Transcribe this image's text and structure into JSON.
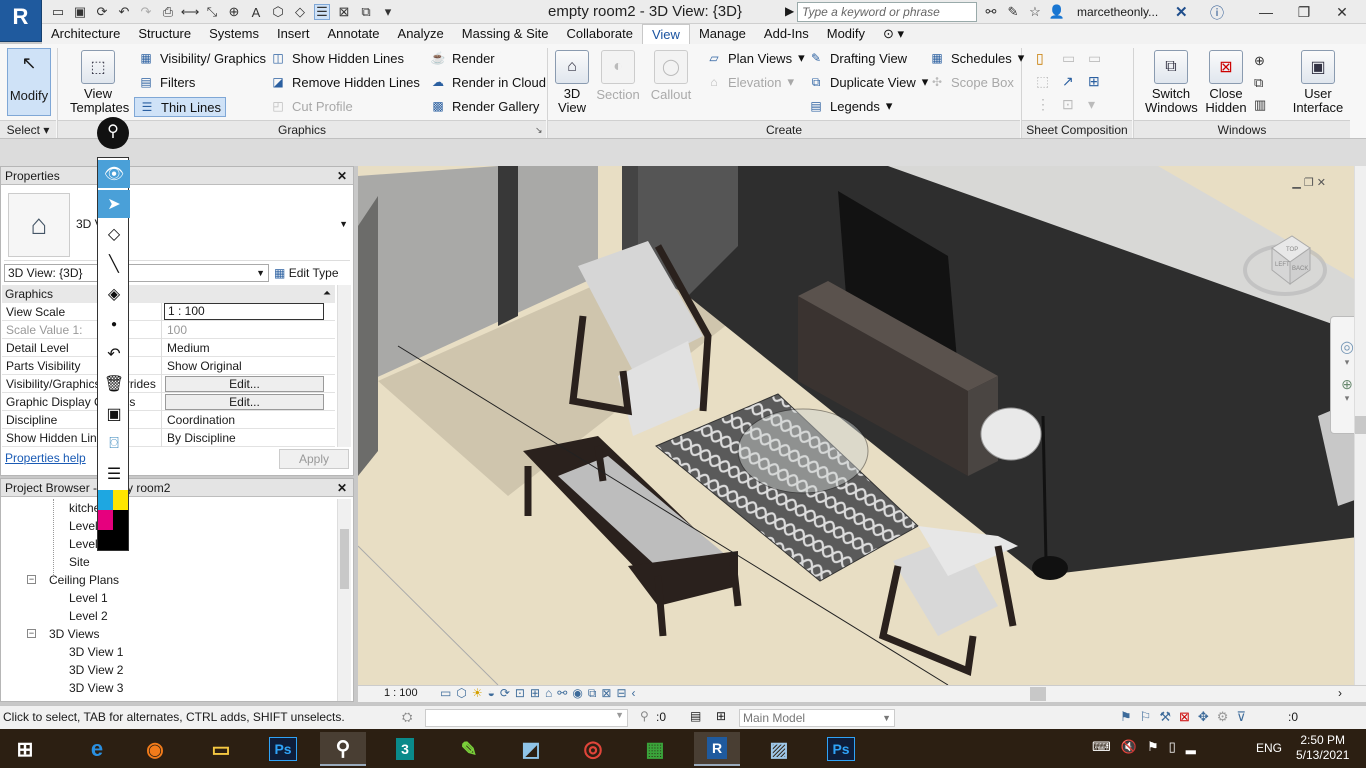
{
  "app": {
    "logo": "R",
    "title": "empty room2 - 3D View: {3D}",
    "search_placeholder": "Type a keyword or phrase",
    "user": "marcetheonly..."
  },
  "menu_tabs": [
    "Architecture",
    "Structure",
    "Systems",
    "Insert",
    "Annotate",
    "Analyze",
    "Massing & Site",
    "Collaborate",
    "View",
    "Manage",
    "Add-Ins",
    "Modify"
  ],
  "active_tab": "View",
  "ribbon": {
    "modify": "Modify",
    "select": "Select",
    "view_templates": "View\nTemplates",
    "visibility": "Visibility/ Graphics",
    "filters": "Filters",
    "thin_lines": "Thin Lines",
    "show_hidden": "Show  Hidden Lines",
    "remove_hidden": "Remove  Hidden Lines",
    "cut_profile": "Cut  Profile",
    "render": "Render",
    "render_cloud": "Render  in Cloud",
    "render_gallery": "Render  Gallery",
    "graphics_panel": "Graphics",
    "view3d": "3D\nView",
    "section": "Section",
    "callout": "Callout",
    "plan_views": "Plan  Views",
    "elevation": "Elevation",
    "drafting_view": "Drafting  View",
    "duplicate_view": "Duplicate  View",
    "legends": "Legends",
    "schedules": "Schedules",
    "scope_box": "Scope  Box",
    "create_panel": "Create",
    "sheet_panel": "Sheet Composition",
    "switch_windows": "Switch\nWindows",
    "close_hidden": "Close\nHidden",
    "user_interface": "User\nInterface",
    "windows_panel": "Windows"
  },
  "properties": {
    "title": "Properties",
    "type_name": "3D View",
    "selector": "3D View: {3D}",
    "edit_type": "Edit Type",
    "section": "Graphics",
    "rows": [
      {
        "label": "View Scale",
        "value": "1 : 100"
      },
      {
        "label": "Scale Value    1:",
        "value": "100"
      },
      {
        "label": "Detail Level",
        "value": "Medium"
      },
      {
        "label": "Parts Visibility",
        "value": "Show Original"
      },
      {
        "label": "Visibility/Graphics Overrides",
        "value": "Edit..."
      },
      {
        "label": "Graphic Display Options",
        "value": "Edit..."
      },
      {
        "label": "Discipline",
        "value": "Coordination"
      },
      {
        "label": "Show Hidden Lines",
        "value": "By Discipline"
      }
    ],
    "help": "Properties help",
    "apply": "Apply"
  },
  "browser": {
    "title": "Project Browser - empty room2",
    "items": [
      {
        "label": "kitchen",
        "indent": 3
      },
      {
        "label": "Level 1",
        "indent": 3
      },
      {
        "label": "Level 2",
        "indent": 3
      },
      {
        "label": "Site",
        "indent": 3
      },
      {
        "label": "Ceiling Plans",
        "indent": 2
      },
      {
        "label": "Level 1",
        "indent": 3
      },
      {
        "label": "Level 2",
        "indent": 3
      },
      {
        "label": "3D Views",
        "indent": 2
      },
      {
        "label": "3D View 1",
        "indent": 3
      },
      {
        "label": "3D View 2",
        "indent": 3
      },
      {
        "label": "3D View 3",
        "indent": 3
      }
    ]
  },
  "viewcube": {
    "face_top": "TOP",
    "face_back": "BACK",
    "face_left": "LEFT"
  },
  "view_bar": {
    "scale": "1 : 100"
  },
  "status": {
    "hint": "Click to select, TAB for alternates, CTRL adds, SHIFT unselects.",
    "selection_count": ":0",
    "model": "Main Model",
    "filter_count": ":0"
  },
  "taskbar": {
    "lang": "ENG",
    "time": "2:50 PM",
    "date": "5/13/2021",
    "apps": [
      "start",
      "edge",
      "firefox",
      "explorer",
      "photoshop",
      "pen-tool",
      "3dsmax",
      "sketch",
      "ruler",
      "chrome",
      "calculator",
      "revit",
      "photos",
      "photoshop2"
    ]
  },
  "colors": {
    "accent": "#1a53a0",
    "taskbar_bg": "#2c1f12",
    "floor": "#e6dcc1",
    "wall_dark": "#2b2b2b"
  }
}
